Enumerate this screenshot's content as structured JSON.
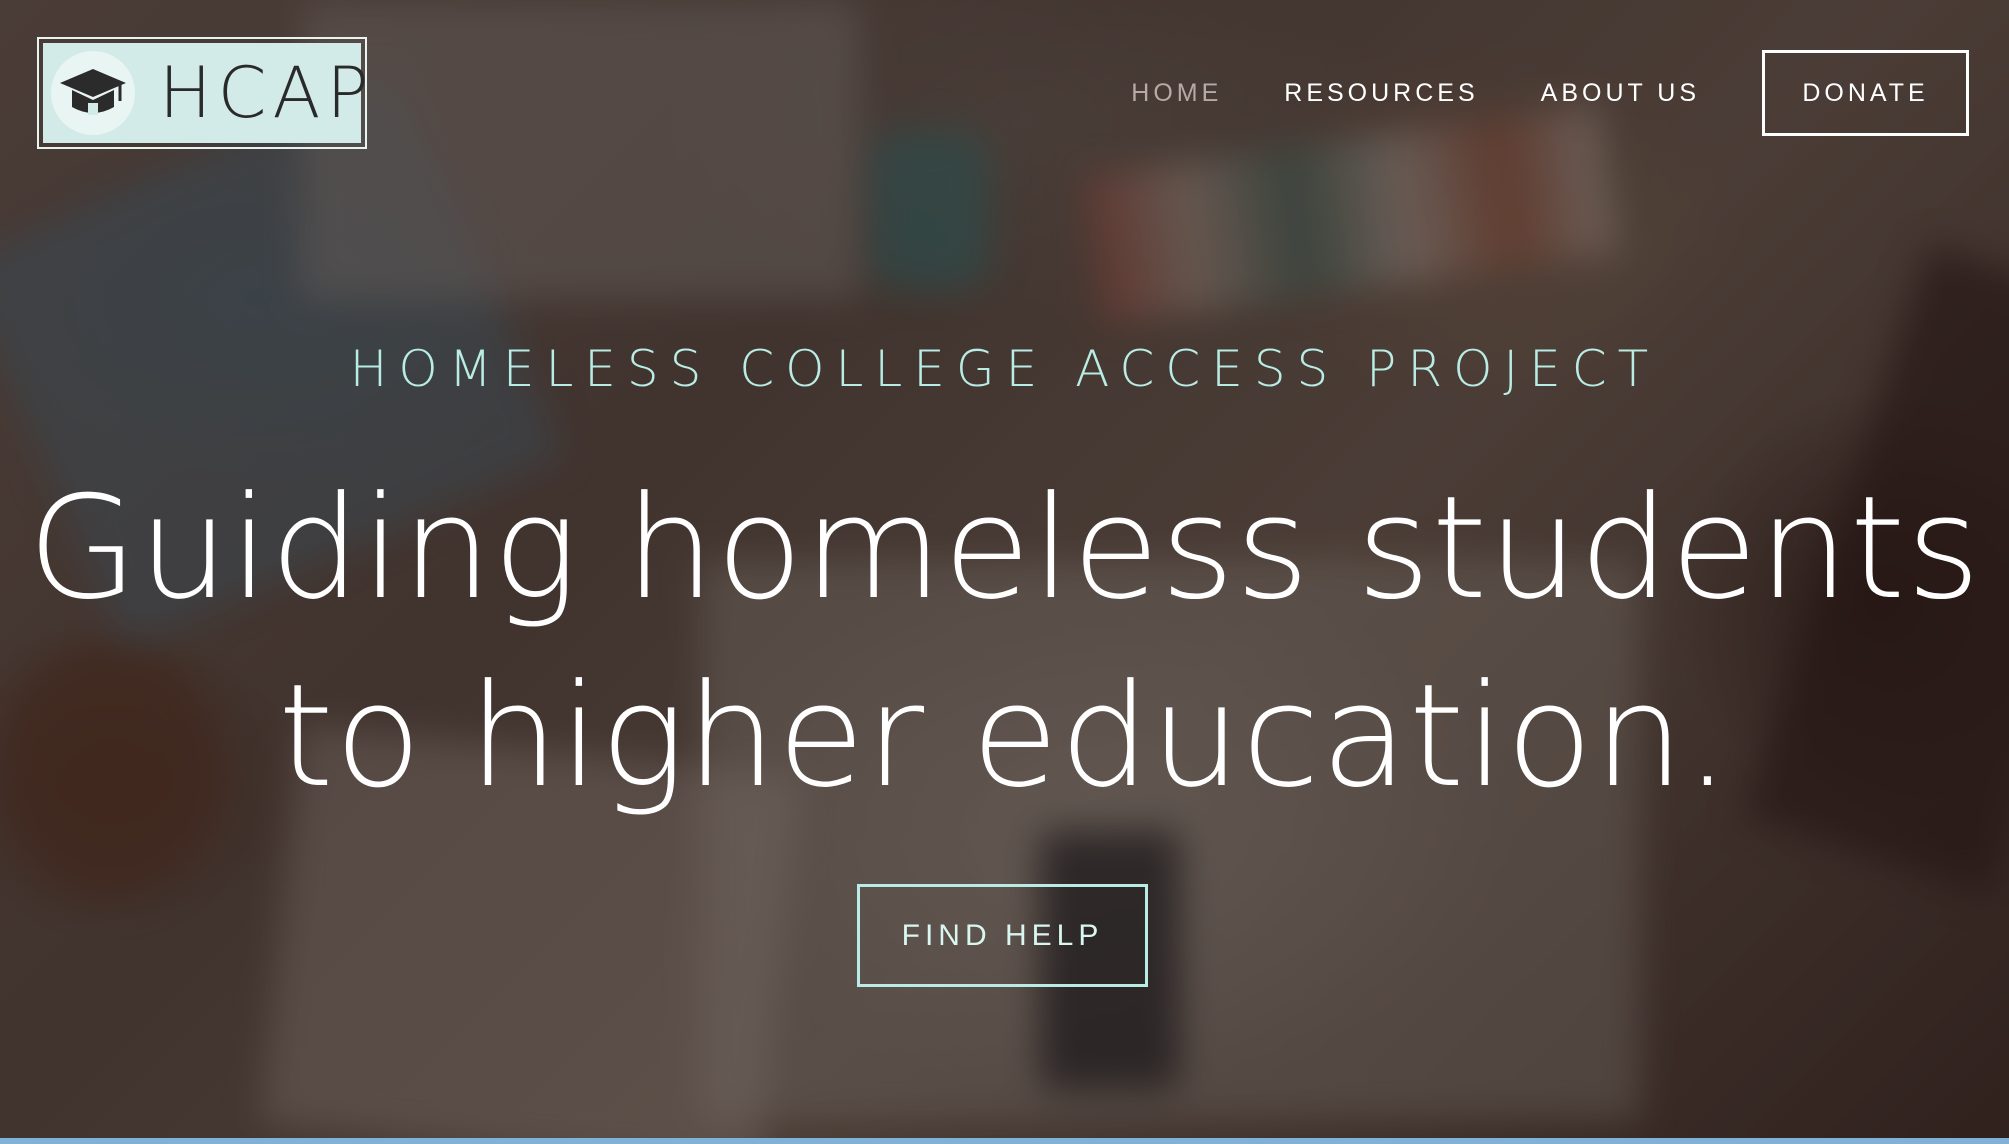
{
  "header": {
    "logo_text": "HCAP",
    "nav": [
      {
        "label": "HOME"
      },
      {
        "label": "RESOURCES"
      },
      {
        "label": "ABOUT US"
      }
    ],
    "donate_label": "DONATE"
  },
  "hero": {
    "eyebrow": "HOMELESS COLLEGE ACCESS PROJECT",
    "headline_line1": "Guiding homeless students",
    "headline_line2": "to higher education.",
    "cta_label": "FIND HELP"
  },
  "colors": {
    "accent": "#b8ece4",
    "logo_background": "#d2ebe8",
    "nav_active": "#b5aaa5",
    "text": "#ffffff"
  },
  "icons": {
    "logo": "graduation-cap-icon"
  }
}
